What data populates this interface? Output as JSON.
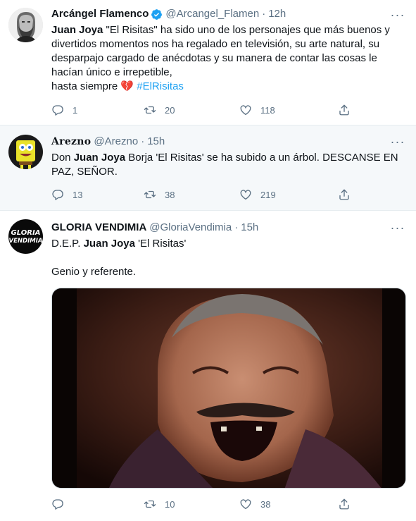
{
  "tweets": [
    {
      "name": "Arcángel Flamenco",
      "handle": "@Arcangel_Flamen",
      "dot": "·",
      "time": "12h",
      "more": "···",
      "text_bold": "Juan Joya",
      "text_line": " \"El Risitas\" ha sido uno de los personajes que más buenos y divertidos momentos nos ha regalado en televisión, su arte natural, su desparpajo cargado de anécdotas y su manera de contar las cosas le hacían único e irrepetible,",
      "text_tail": "hasta siempre ",
      "broken_heart": "💔",
      "hashtag": "#ElRisitas",
      "replies": "1",
      "retweets": "20",
      "likes": "118"
    },
    {
      "name": "Arezno",
      "handle": "@Arezno",
      "dot": "·",
      "time": "15h",
      "more": "···",
      "text_pre": "Don ",
      "text_bold": "Juan Joya",
      "text_post": " Borja 'El Risitas' se ha subido a un árbol. DESCANSE EN PAZ, SEÑOR.",
      "replies": "13",
      "retweets": "38",
      "likes": "219"
    },
    {
      "name": "GLORIA VENDIMIA",
      "handle": "@GloriaVendimia",
      "dot": "·",
      "time": "15h",
      "more": "···",
      "text_pre": "D.E.P. ",
      "text_bold": "Juan Joya",
      "text_post": " 'El Risitas'",
      "text_para2": "Genio y referente.",
      "avatar_text_1": "GLORIA",
      "avatar_text_2": "VENDIMIA",
      "replies": "",
      "retweets": "10",
      "likes": "38"
    }
  ],
  "icons": {
    "reply": "reply-icon",
    "retweet": "retweet-icon",
    "like": "heart-icon",
    "share": "share-icon",
    "verified": "verified-badge-icon"
  },
  "colors": {
    "text": "#0f1419",
    "secondary": "#5b7083",
    "link": "#1da1f2",
    "highlight_bg": "#f5f8fa",
    "divider": "#e6ecf0"
  }
}
